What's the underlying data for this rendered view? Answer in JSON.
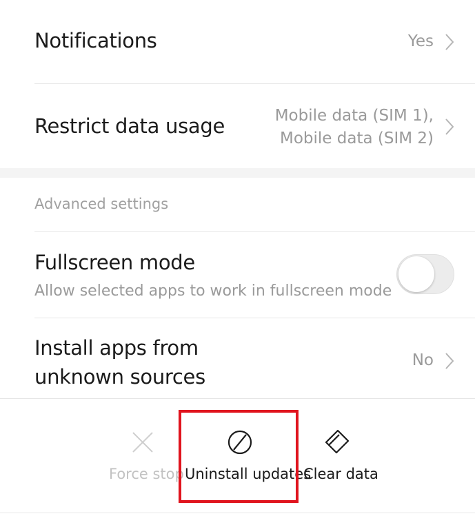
{
  "settings": {
    "notifications": {
      "title": "Notifications",
      "value": "Yes"
    },
    "restrict_data": {
      "title": "Restrict data usage",
      "value": "Mobile data (SIM 1), Mobile data (SIM 2)"
    },
    "advanced_header": "Advanced settings",
    "fullscreen": {
      "title": "Fullscreen mode",
      "subtitle": "Allow selected apps to work in fullscreen mode",
      "enabled": false
    },
    "install_unknown": {
      "title": "Install apps from unknown sources",
      "value": "No"
    }
  },
  "actions": {
    "force_stop": {
      "label": "Force stop",
      "icon": "close-icon",
      "enabled": false
    },
    "uninstall_updates": {
      "label": "Uninstall updates",
      "icon": "block-icon",
      "highlighted": true
    },
    "clear_data": {
      "label": "Clear data",
      "icon": "eraser-icon"
    }
  },
  "colors": {
    "highlight": "#e0141e",
    "disabled_text": "#c2c2c2",
    "secondary_text": "#9a9a9a"
  }
}
